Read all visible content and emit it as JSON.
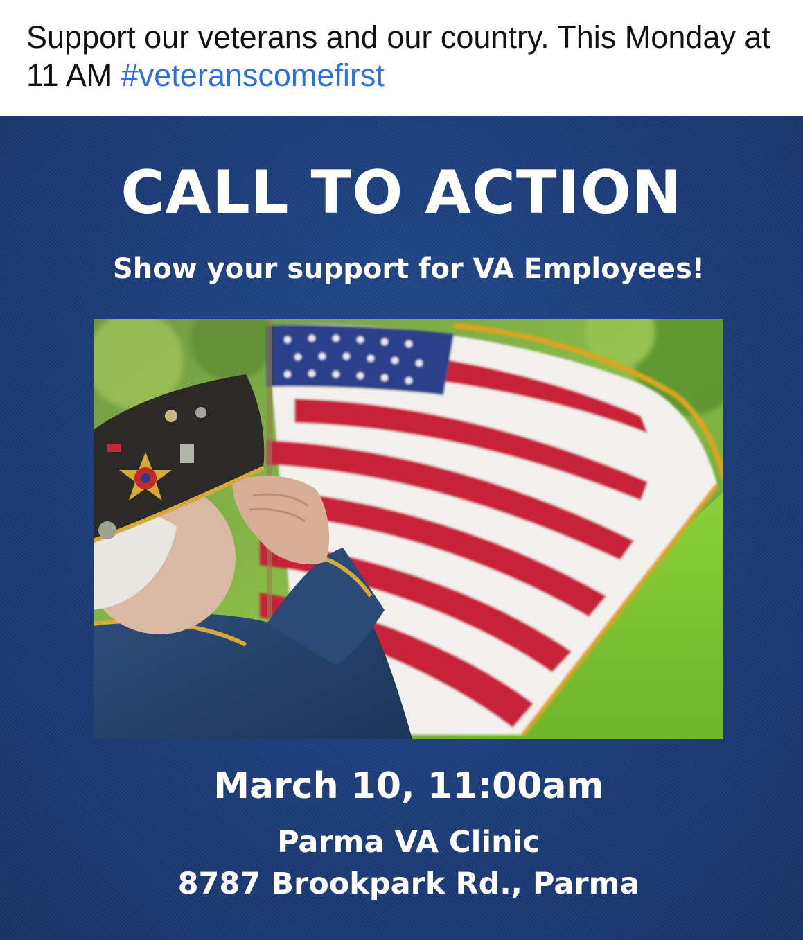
{
  "post": {
    "caption_text": "Support our veterans and our country. This Monday at 11 AM ",
    "hashtag": "#veteranscomefirst"
  },
  "flyer": {
    "headline": "CALL TO ACTION",
    "subheadline": "Show your support for VA Employees!",
    "date_time": "March 10, 11:00am",
    "venue": "Parma VA Clinic",
    "address": "8787 Brookpark Rd., Parma"
  },
  "colors": {
    "flyer_background": "#1d3d7a",
    "hashtag_link": "#2f6fdc",
    "flag_red": "#c8243b",
    "flag_blue": "#2a3f8a"
  }
}
